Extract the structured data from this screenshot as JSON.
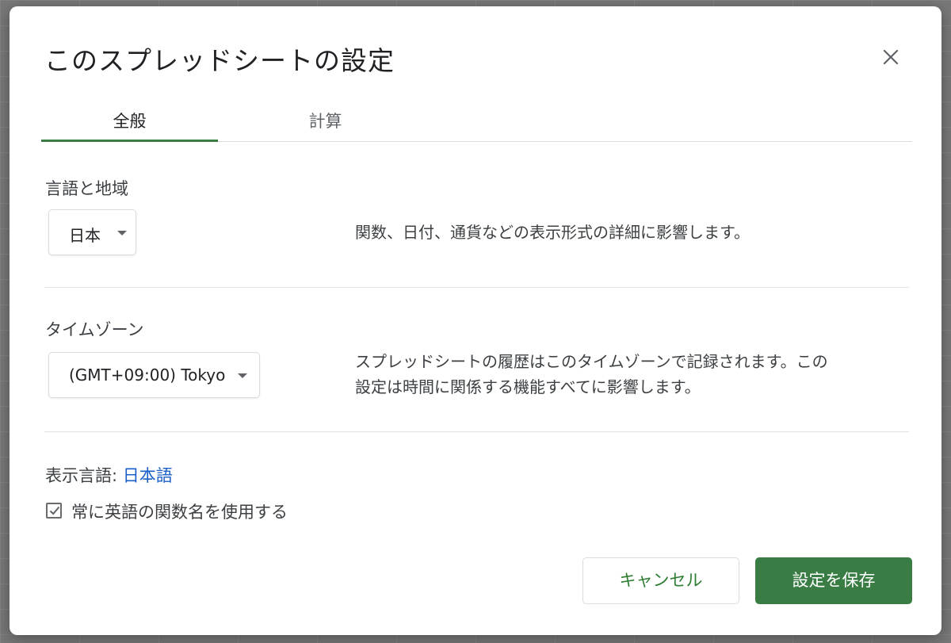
{
  "dialog": {
    "title": "このスプレッドシートの設定",
    "close_icon": "close-icon"
  },
  "tabs": [
    {
      "label": "全般",
      "active": true
    },
    {
      "label": "計算",
      "active": false
    }
  ],
  "locale": {
    "label": "言語と地域",
    "selected": "日本",
    "description": "関数、日付、通貨などの表示形式の詳細に影響します。"
  },
  "timezone": {
    "label": "タイムゾーン",
    "selected": "(GMT+09:00) Tokyo",
    "description_line1": "スプレッドシートの履歴はこのタイムゾーンで記録されます。この",
    "description_line2": "設定は時間に関係する機能すべてに影響します。"
  },
  "display_language": {
    "label": "表示言語:",
    "value": "日本語"
  },
  "english_function_names": {
    "label": "常に英語の関数名を使用する",
    "checked": true
  },
  "buttons": {
    "cancel": "キャンセル",
    "save": "設定を保存"
  },
  "colors": {
    "accent": "#3a7d44",
    "link": "#1a5fc7"
  }
}
